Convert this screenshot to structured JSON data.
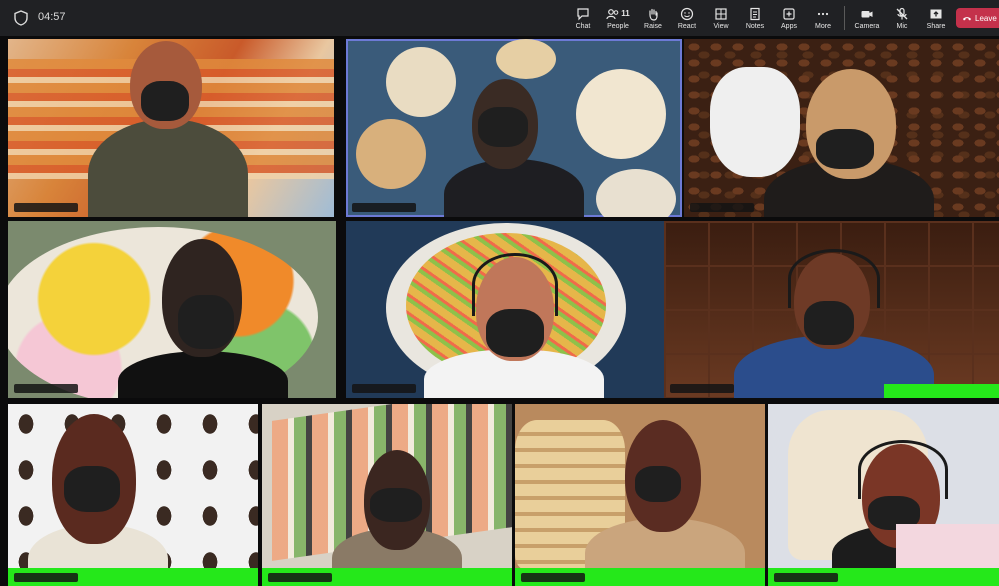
{
  "meeting": {
    "timer": "04:57"
  },
  "toolbar": {
    "chat": "Chat",
    "people_count": "11",
    "people": "People",
    "raise": "Raise",
    "react": "React",
    "view": "View",
    "notes": "Notes",
    "apps": "Apps",
    "more": "More",
    "camera": "Camera",
    "mic": "Mic",
    "share": "Share",
    "leave": "Leave"
  },
  "colors": {
    "leave_button": "#c4314b",
    "active_speaker_border": "#6d7ad6",
    "green_screen": "#25e81a",
    "toolbar_bg": "#202124"
  },
  "participants": [
    {
      "background": "lasagna"
    },
    {
      "background": "food-platters",
      "active_speaker": true
    },
    {
      "background": "coffee-beans"
    },
    {
      "background": "fruit-bowl"
    },
    {
      "background": "noodle-salad"
    },
    {
      "background": "chocolate"
    },
    {
      "background": "nutella-jars"
    },
    {
      "background": "sushi"
    },
    {
      "background": "sandwich"
    },
    {
      "background": "bread"
    }
  ]
}
